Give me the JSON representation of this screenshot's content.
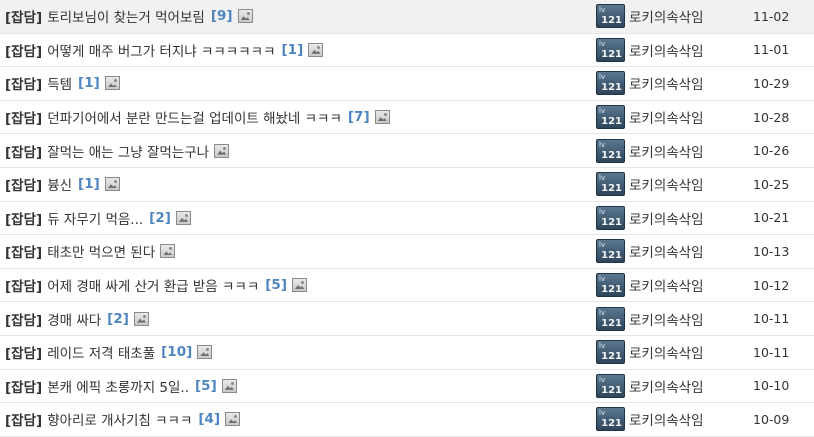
{
  "board": {
    "posts": [
      {
        "category": "[잡담]",
        "subject": "토리보님이 찾는거 먹어보림",
        "comment_count": "[9]",
        "has_image": true,
        "author": "로키의속삭임",
        "level_badge": {
          "label": "lv",
          "value": "121"
        },
        "date": "11-02"
      },
      {
        "category": "[잡담]",
        "subject": "어떻게 매주 버그가 터지냐 ㅋㅋㅋㅋㅋㅋ",
        "comment_count": "[1]",
        "has_image": true,
        "author": "로키의속삭임",
        "level_badge": {
          "label": "lv",
          "value": "121"
        },
        "date": "11-01"
      },
      {
        "category": "[잡담]",
        "subject": "득템",
        "comment_count": "[1]",
        "has_image": true,
        "author": "로키의속삭임",
        "level_badge": {
          "label": "lv",
          "value": "121"
        },
        "date": "10-29"
      },
      {
        "category": "[잡담]",
        "subject": "던파기어에서 분란 만드는걸 업데이트 해놨네 ㅋㅋㅋ",
        "comment_count": "[7]",
        "has_image": true,
        "author": "로키의속삭임",
        "level_badge": {
          "label": "lv",
          "value": "121"
        },
        "date": "10-28"
      },
      {
        "category": "[잡담]",
        "subject": "잘먹는 애는 그냥 잘먹는구나",
        "comment_count": "",
        "has_image": true,
        "author": "로키의속삭임",
        "level_badge": {
          "label": "lv",
          "value": "121"
        },
        "date": "10-26"
      },
      {
        "category": "[잡담]",
        "subject": "븅신",
        "comment_count": "[1]",
        "has_image": true,
        "author": "로키의속삭임",
        "level_badge": {
          "label": "lv",
          "value": "121"
        },
        "date": "10-25"
      },
      {
        "category": "[잡담]",
        "subject": "듀 자무기 먹음...",
        "comment_count": "[2]",
        "has_image": true,
        "author": "로키의속삭임",
        "level_badge": {
          "label": "lv",
          "value": "121"
        },
        "date": "10-21"
      },
      {
        "category": "[잡담]",
        "subject": "태초만 먹으면 된다",
        "comment_count": "",
        "has_image": true,
        "author": "로키의속삭임",
        "level_badge": {
          "label": "lv",
          "value": "121"
        },
        "date": "10-13"
      },
      {
        "category": "[잡담]",
        "subject": "어제 경매 싸게 산거 환급 받음 ㅋㅋㅋ",
        "comment_count": "[5]",
        "has_image": true,
        "author": "로키의속삭임",
        "level_badge": {
          "label": "lv",
          "value": "121"
        },
        "date": "10-12"
      },
      {
        "category": "[잡담]",
        "subject": "경매 싸다",
        "comment_count": "[2]",
        "has_image": true,
        "author": "로키의속삭임",
        "level_badge": {
          "label": "lv",
          "value": "121"
        },
        "date": "10-11"
      },
      {
        "category": "[잡담]",
        "subject": "레이드 저격 태초풀",
        "comment_count": "[10]",
        "has_image": true,
        "author": "로키의속삭임",
        "level_badge": {
          "label": "lv",
          "value": "121"
        },
        "date": "10-11"
      },
      {
        "category": "[잡담]",
        "subject": "본캐 에픽 초롱까지 5일..",
        "comment_count": "[5]",
        "has_image": true,
        "author": "로키의속삭임",
        "level_badge": {
          "label": "lv",
          "value": "121"
        },
        "date": "10-10"
      },
      {
        "category": "[잡담]",
        "subject": "향아리로 개사기침 ㅋㅋㅋ",
        "comment_count": "[4]",
        "has_image": true,
        "author": "로키의속삭임",
        "level_badge": {
          "label": "lv",
          "value": "121"
        },
        "date": "10-09"
      }
    ]
  },
  "icons": {
    "attached_image": "image-attachment-icon",
    "level_badge": "level-badge-icon"
  },
  "colors": {
    "comment_count": "#4f85c0",
    "text": "#333333",
    "row_divider": "#e6e6e6",
    "highlight_row": "#f1f1f1"
  }
}
